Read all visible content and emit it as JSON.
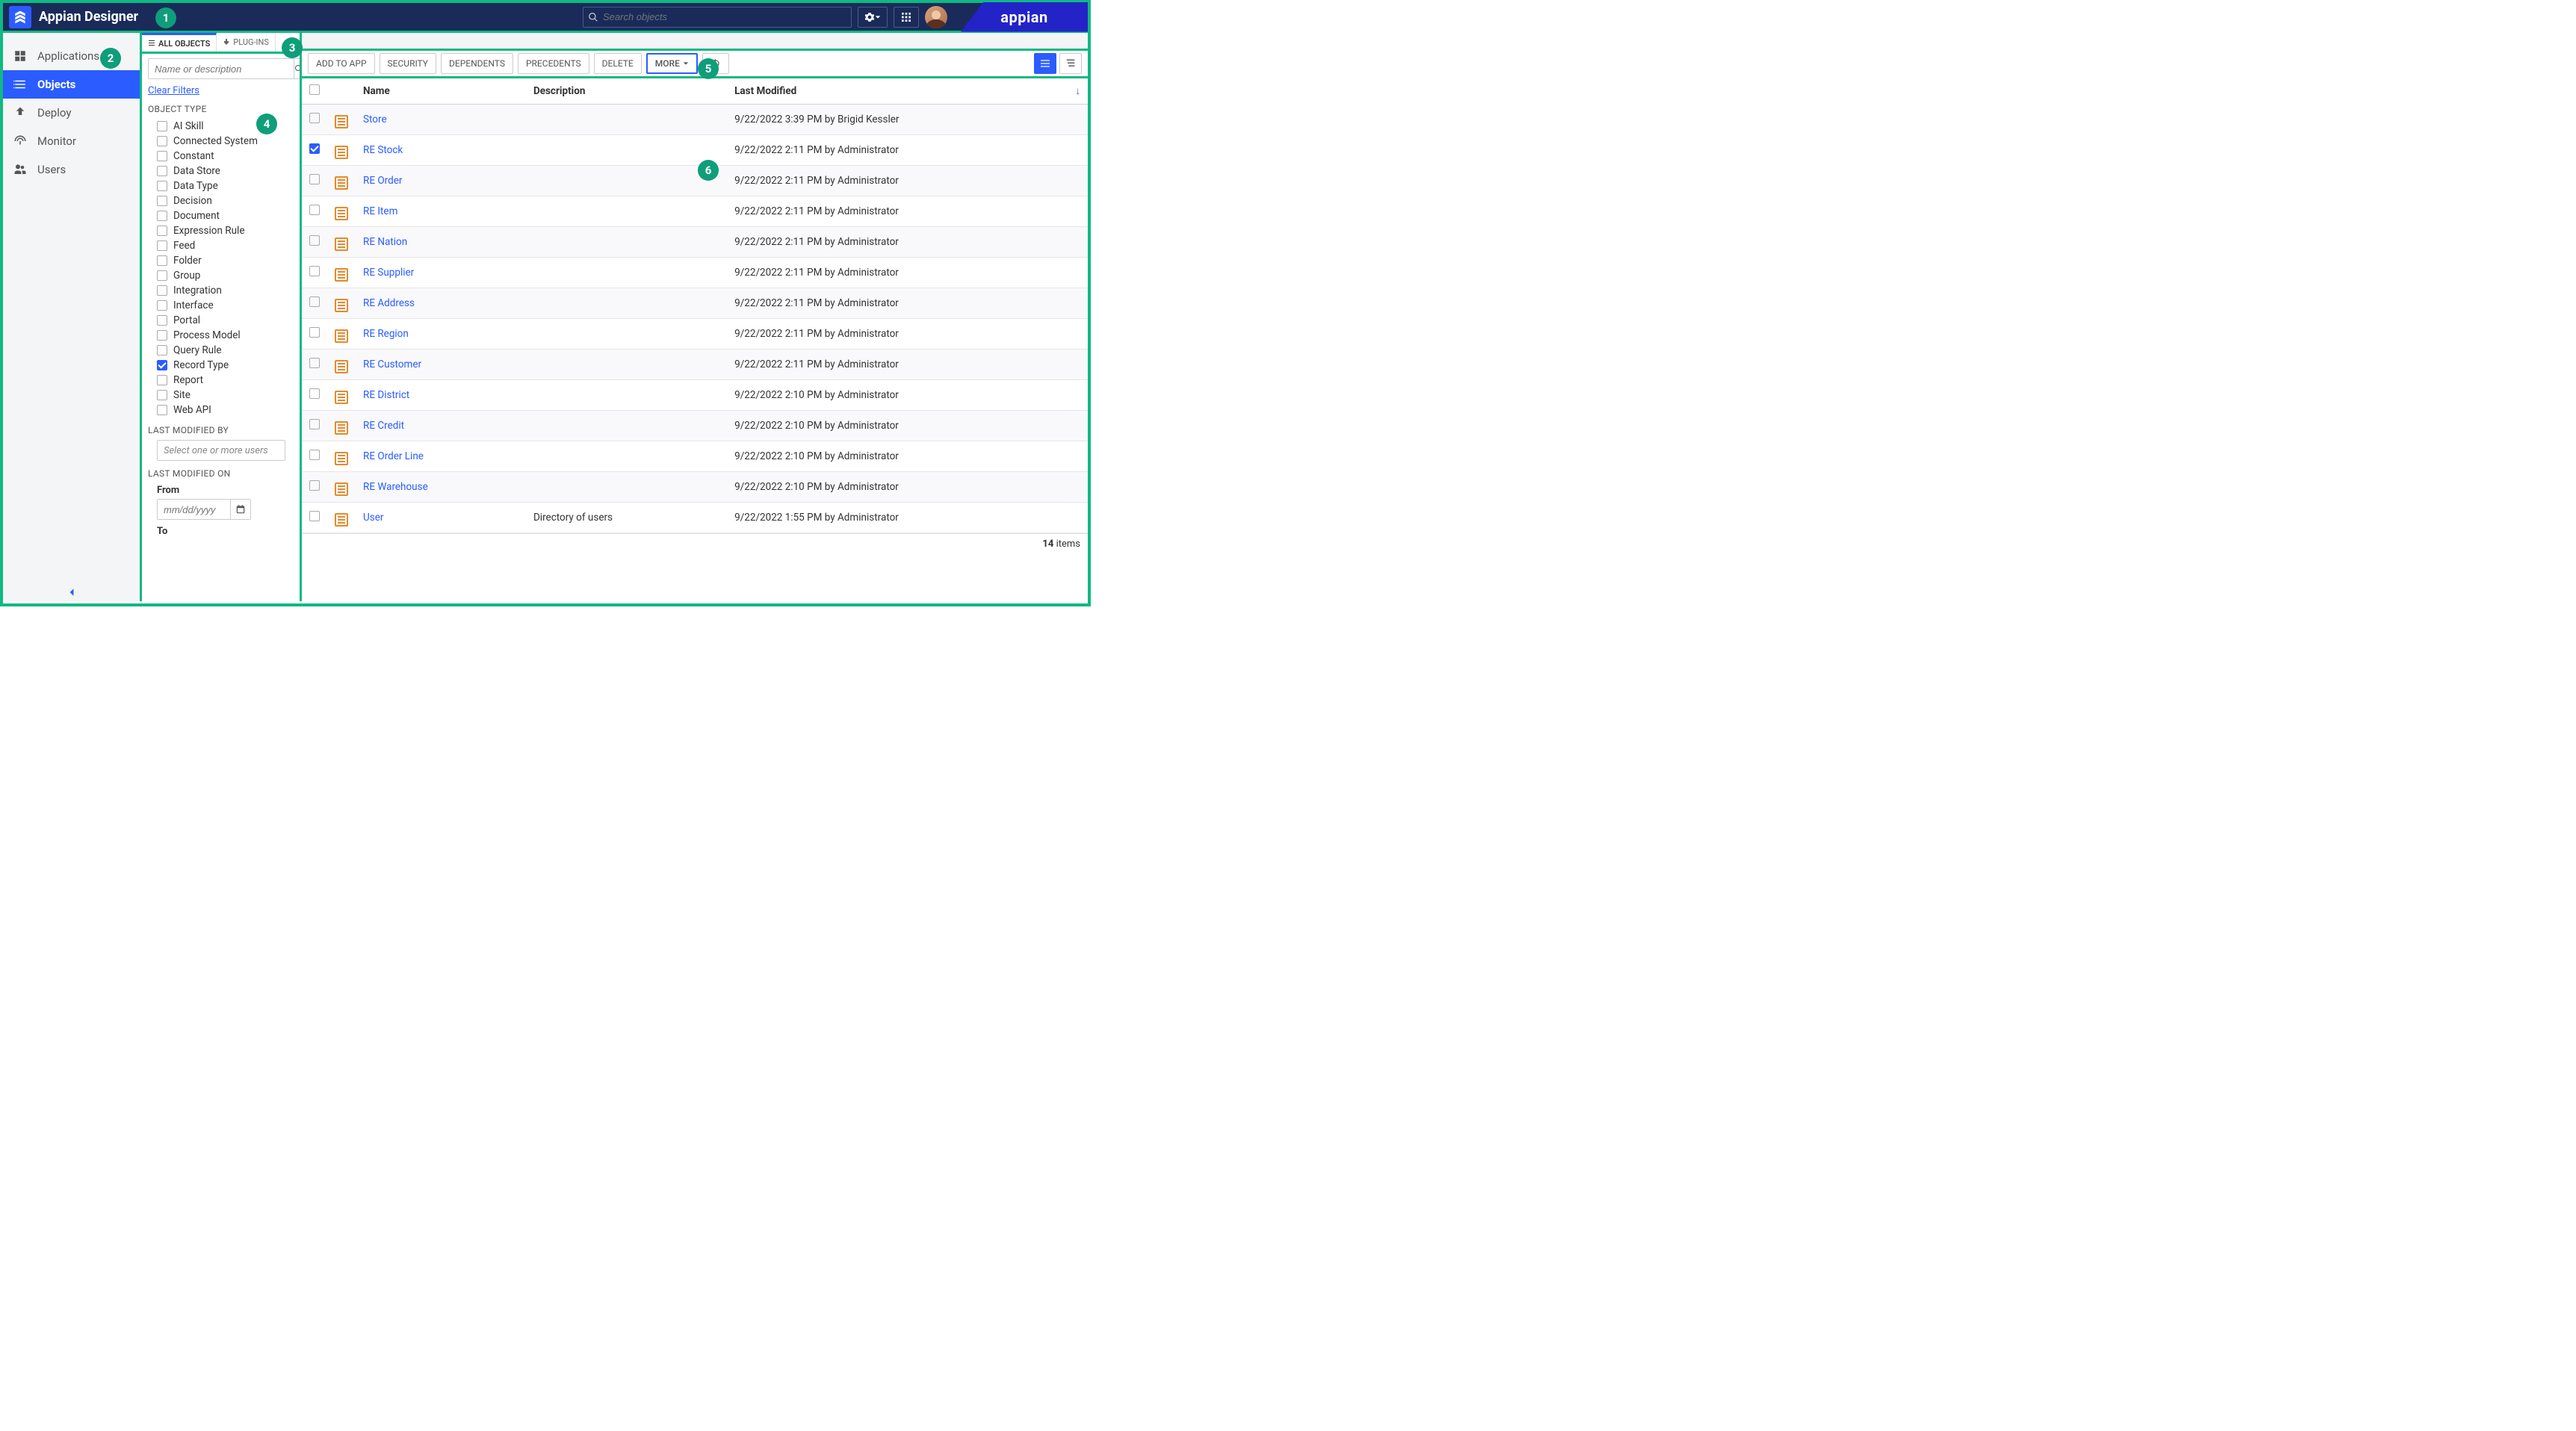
{
  "header": {
    "title": "Appian Designer",
    "search_placeholder": "Search objects",
    "brand": "appian"
  },
  "sidebar": {
    "items": [
      {
        "icon": "apps",
        "label": "Applications"
      },
      {
        "icon": "objects",
        "label": "Objects"
      },
      {
        "icon": "deploy",
        "label": "Deploy"
      },
      {
        "icon": "monitor",
        "label": "Monitor"
      },
      {
        "icon": "users",
        "label": "Users"
      }
    ],
    "active_index": 1
  },
  "filters": {
    "tabs": [
      {
        "label": "ALL OBJECTS",
        "active": true
      },
      {
        "label": "PLUG-INS",
        "active": false
      }
    ],
    "search_placeholder": "Name or description",
    "clear_label": "Clear Filters",
    "sections": {
      "object_type_label": "OBJECT TYPE",
      "object_types": [
        {
          "label": "AI Skill",
          "checked": false
        },
        {
          "label": "Connected System",
          "checked": false
        },
        {
          "label": "Constant",
          "checked": false
        },
        {
          "label": "Data Store",
          "checked": false
        },
        {
          "label": "Data Type",
          "checked": false
        },
        {
          "label": "Decision",
          "checked": false
        },
        {
          "label": "Document",
          "checked": false
        },
        {
          "label": "Expression Rule",
          "checked": false
        },
        {
          "label": "Feed",
          "checked": false
        },
        {
          "label": "Folder",
          "checked": false
        },
        {
          "label": "Group",
          "checked": false
        },
        {
          "label": "Integration",
          "checked": false
        },
        {
          "label": "Interface",
          "checked": false
        },
        {
          "label": "Portal",
          "checked": false
        },
        {
          "label": "Process Model",
          "checked": false
        },
        {
          "label": "Query Rule",
          "checked": false
        },
        {
          "label": "Record Type",
          "checked": true
        },
        {
          "label": "Report",
          "checked": false
        },
        {
          "label": "Site",
          "checked": false
        },
        {
          "label": "Web API",
          "checked": false
        }
      ],
      "modified_by_label": "LAST MODIFIED BY",
      "modified_by_placeholder": "Select one or more users",
      "modified_on_label": "LAST MODIFIED ON",
      "from_label": "From",
      "to_label": "To",
      "date_placeholder": "mm/dd/yyyy"
    }
  },
  "toolbar": {
    "buttons": [
      "ADD TO APP",
      "SECURITY",
      "DEPENDENTS",
      "PRECEDENTS",
      "DELETE"
    ],
    "more_label": "MORE"
  },
  "grid": {
    "columns": {
      "name": "Name",
      "description": "Description",
      "last_modified": "Last Modified"
    },
    "rows": [
      {
        "checked": false,
        "name": "Store",
        "description": "",
        "modified": "9/22/2022 3:39 PM by Brigid Kessler"
      },
      {
        "checked": true,
        "name": "RE Stock",
        "description": "",
        "modified": "9/22/2022 2:11 PM by Administrator"
      },
      {
        "checked": false,
        "name": "RE Order",
        "description": "",
        "modified": "9/22/2022 2:11 PM by Administrator"
      },
      {
        "checked": false,
        "name": "RE Item",
        "description": "",
        "modified": "9/22/2022 2:11 PM by Administrator"
      },
      {
        "checked": false,
        "name": "RE Nation",
        "description": "",
        "modified": "9/22/2022 2:11 PM by Administrator"
      },
      {
        "checked": false,
        "name": "RE Supplier",
        "description": "",
        "modified": "9/22/2022 2:11 PM by Administrator"
      },
      {
        "checked": false,
        "name": "RE Address",
        "description": "",
        "modified": "9/22/2022 2:11 PM by Administrator"
      },
      {
        "checked": false,
        "name": "RE Region",
        "description": "",
        "modified": "9/22/2022 2:11 PM by Administrator"
      },
      {
        "checked": false,
        "name": "RE Customer",
        "description": "",
        "modified": "9/22/2022 2:11 PM by Administrator"
      },
      {
        "checked": false,
        "name": "RE District",
        "description": "",
        "modified": "9/22/2022 2:10 PM by Administrator"
      },
      {
        "checked": false,
        "name": "RE Credit",
        "description": "",
        "modified": "9/22/2022 2:10 PM by Administrator"
      },
      {
        "checked": false,
        "name": "RE Order Line",
        "description": "",
        "modified": "9/22/2022 2:10 PM by Administrator"
      },
      {
        "checked": false,
        "name": "RE Warehouse",
        "description": "",
        "modified": "9/22/2022 2:10 PM by Administrator"
      },
      {
        "checked": false,
        "name": "User",
        "description": "Directory of users",
        "modified": "9/22/2022 1:55 PM by Administrator"
      }
    ],
    "footer": {
      "count": "14",
      "suffix": " items"
    }
  },
  "badges": [
    "1",
    "2",
    "3",
    "4",
    "5",
    "6"
  ]
}
